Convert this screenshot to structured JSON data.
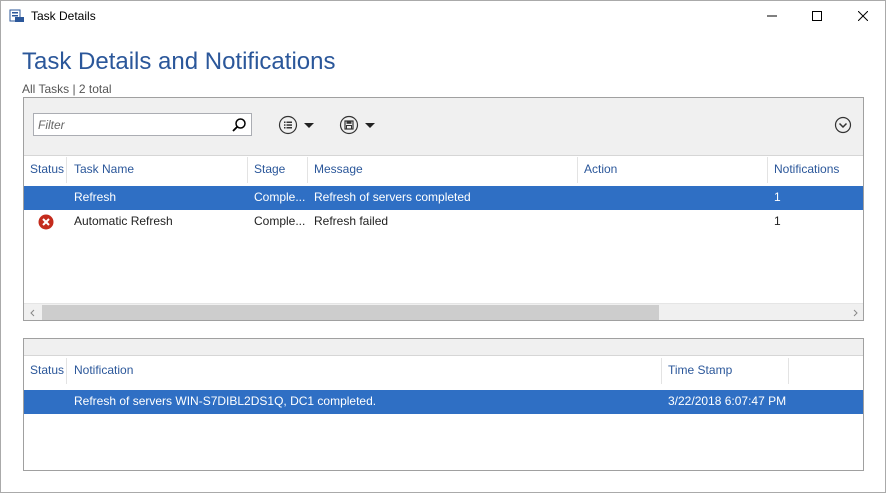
{
  "window": {
    "title": "Task Details",
    "controls": {
      "minimize": "minimize",
      "maximize": "maximize",
      "close": "close"
    }
  },
  "header": {
    "title": "Task Details and Notifications",
    "subtitle": "All Tasks | 2 total"
  },
  "toolbar": {
    "filter_placeholder": "Filter",
    "icons": [
      "search-icon",
      "list-view-icon",
      "save-icon",
      "expand-circle-icon"
    ]
  },
  "tasks": {
    "columns": [
      "Status",
      "Task Name",
      "Stage",
      "Message",
      "Action",
      "Notifications"
    ],
    "rows": [
      {
        "status": "",
        "task_name": "Refresh",
        "stage": "Comple...",
        "message": "Refresh of servers completed",
        "action": "",
        "notifications": "1",
        "selected": true
      },
      {
        "status": "error",
        "task_name": "Automatic Refresh",
        "stage": "Comple...",
        "message": "Refresh failed",
        "action": "",
        "notifications": "1",
        "selected": false
      }
    ]
  },
  "notifications": {
    "columns": [
      "Status",
      "Notification",
      "Time Stamp"
    ],
    "rows": [
      {
        "status": "",
        "notification": "Refresh of servers WIN-S7DIBL2DS1Q, DC1 completed.",
        "timestamp": "3/22/2018 6:07:47 PM",
        "selected": true
      }
    ]
  },
  "colors": {
    "accent": "#2b579a",
    "selection": "#2f6fc4",
    "error": "#c42b1c"
  }
}
